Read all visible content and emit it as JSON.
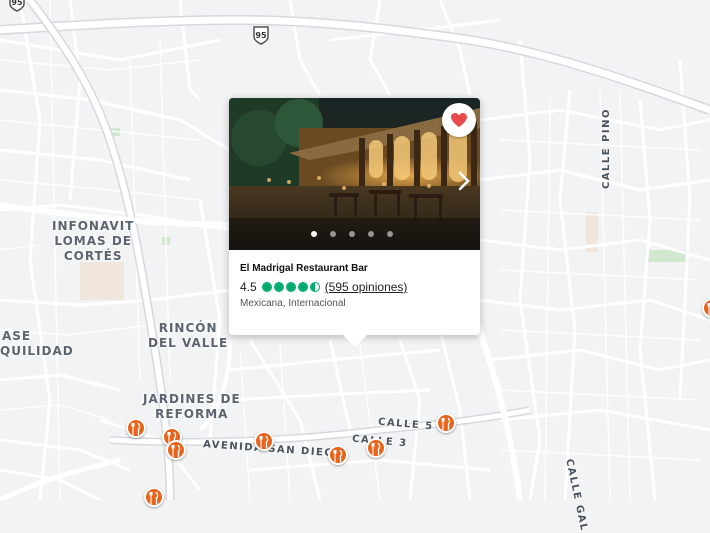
{
  "map": {
    "area_labels": [
      {
        "id": "infonavit",
        "lines": [
          "INFONAVIT",
          "LOMAS DE",
          "CORTÉS"
        ]
      },
      {
        "id": "rincon",
        "lines": [
          "RINCÓN",
          "DEL VALLE"
        ]
      },
      {
        "id": "jardines",
        "lines": [
          "JARDINES DE",
          "REFORMA"
        ]
      },
      {
        "id": "tranquilidad",
        "lines": [
          "ASE",
          "QUILIDAD"
        ]
      }
    ],
    "street_labels": [
      {
        "id": "calle-pino",
        "text": "CALLE PINO"
      },
      {
        "id": "calle-5",
        "text": "CALLE 5"
      },
      {
        "id": "calle-3",
        "text": "CALLE 3"
      },
      {
        "id": "avenida-san-diego",
        "text": "AVENIDA SAN DIEGO"
      },
      {
        "id": "calle-gal",
        "text": "CALLE GAL"
      }
    ],
    "highway_shields": [
      {
        "id": "shield-95-top",
        "number": "95"
      },
      {
        "id": "shield-95",
        "number": "95"
      }
    ],
    "restaurant_pins": 9
  },
  "popup": {
    "favorite_icon": "heart-icon",
    "next_icon": "chevron-right-icon",
    "photo_count": 5,
    "active_photo": 0,
    "name": "El Madrigal Restaurant Bar",
    "rating": "4.5",
    "rating_value": 4.5,
    "reviews": "(595 opiniones)",
    "cuisine": "Mexicana, Internacional",
    "colors": {
      "rating": "#00aa6c",
      "heart": "#e84b4b",
      "pin": "#e8641c"
    }
  }
}
